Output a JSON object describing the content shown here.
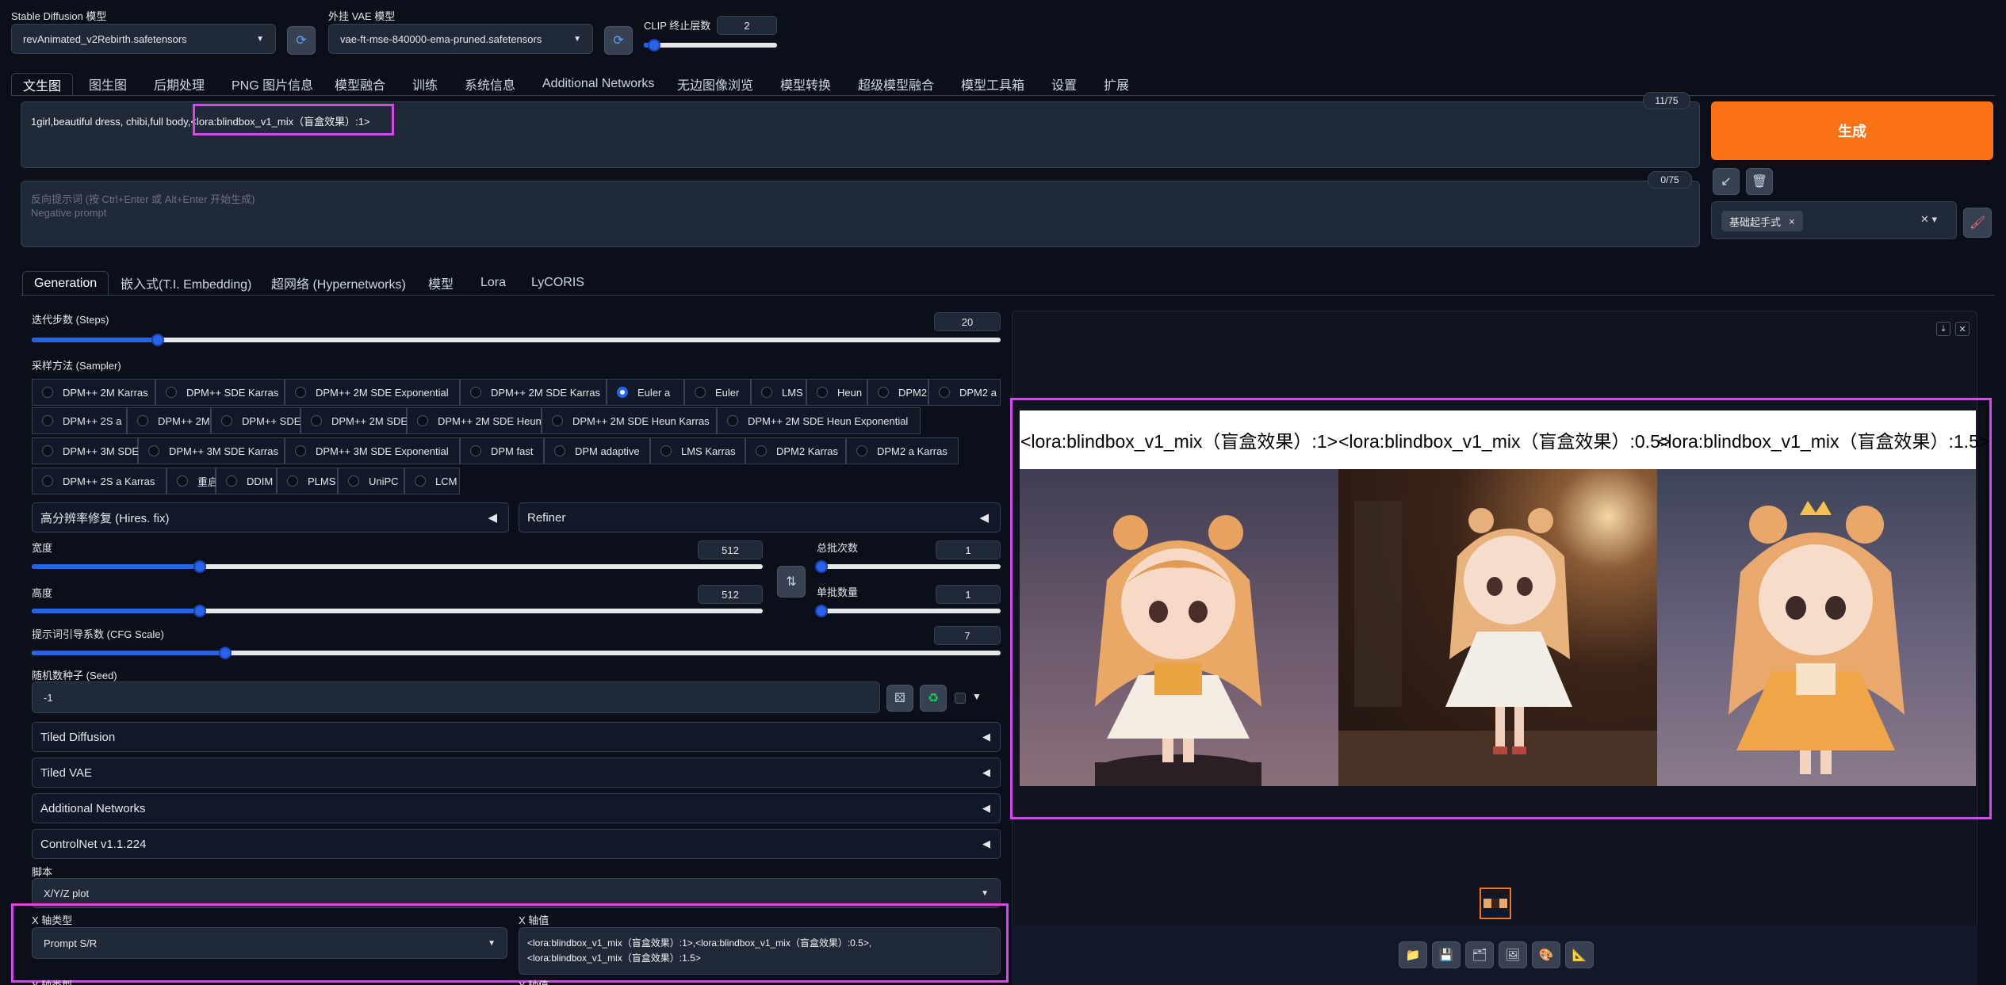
{
  "top": {
    "model_label": "Stable Diffusion 模型",
    "model_value": "revAnimated_v2Rebirth.safetensors",
    "vae_label": "外挂 VAE 模型",
    "vae_value": "vae-ft-mse-840000-ema-pruned.safetensors",
    "clip_label": "CLIP 终止层数",
    "clip_value": "2",
    "clip_level": 0.08
  },
  "tabs": [
    "文生图",
    "图生图",
    "后期处理",
    "PNG 图片信息",
    "模型融合",
    "训练",
    "系统信息",
    "Additional Networks",
    "无边图像浏览",
    "模型转换",
    "超级模型融合",
    "模型工具箱",
    "设置",
    "扩展"
  ],
  "prompt": {
    "text_before": "1girl,beautiful dress, chibi,full body,",
    "text_lora": "<lora:blindbox_v1_mix（盲盒效果）:1>",
    "count": "11/75",
    "neg_placeholder_1": "反向提示词 (按 Ctrl+Enter 或 Alt+Enter 开始生成)",
    "neg_placeholder_2": "Negative prompt",
    "neg_count": "0/75"
  },
  "generate": {
    "label": "生成",
    "style_tag": "基础起手式",
    "colors": {
      "accent": "#f97316"
    }
  },
  "subtabs": [
    "Generation",
    "嵌入式(T.I. Embedding)",
    "超网络 (Hypernetworks)",
    "模型",
    "Lora",
    "LyCORIS"
  ],
  "steps": {
    "label": "迭代步数 (Steps)",
    "value": "20",
    "level": 0.13
  },
  "sampler": {
    "label": "采样方法 (Sampler)",
    "selected": "Euler a",
    "rows": [
      [
        "DPM++ 2M Karras",
        "DPM++ SDE Karras",
        "DPM++ 2M SDE Exponential",
        "DPM++ 2M SDE Karras",
        "Euler a",
        "Euler",
        "LMS",
        "Heun",
        "DPM2",
        "DPM2 a"
      ],
      [
        "DPM++ 2S a",
        "DPM++ 2M",
        "DPM++ SDE",
        "DPM++ 2M SDE",
        "DPM++ 2M SDE Heun",
        "DPM++ 2M SDE Heun Karras",
        "DPM++ 2M SDE Heun Exponential"
      ],
      [
        "DPM++ 3M SDE",
        "DPM++ 3M SDE Karras",
        "DPM++ 3M SDE Exponential",
        "DPM fast",
        "DPM adaptive",
        "LMS Karras",
        "DPM2 Karras",
        "DPM2 a Karras"
      ],
      [
        "DPM++ 2S a Karras",
        "重启",
        "DDIM",
        "PLMS",
        "UniPC",
        "LCM"
      ]
    ]
  },
  "hires": {
    "label": "高分辨率修复 (Hires. fix)"
  },
  "refiner": {
    "label": "Refiner"
  },
  "width": {
    "label": "宽度",
    "value": "512",
    "level": 0.23
  },
  "height": {
    "label": "高度",
    "value": "512",
    "level": 0.23
  },
  "batch_count": {
    "label": "总批次数",
    "value": "1",
    "level": 0.0
  },
  "batch_size": {
    "label": "单批数量",
    "value": "1",
    "level": 0.0
  },
  "cfg": {
    "label": "提示词引导系数 (CFG Scale)",
    "value": "7",
    "level": 0.2
  },
  "seed": {
    "label": "随机数种子 (Seed)",
    "value": "-1"
  },
  "accordions": [
    "Tiled Diffusion",
    "Tiled VAE",
    "Additional Networks",
    "ControlNet v1.1.224"
  ],
  "script": {
    "label": "脚本",
    "value": "X/Y/Z plot"
  },
  "xaxis": {
    "type_label": "X 轴类型",
    "type_value": "Prompt S/R",
    "values_label": "X 轴值",
    "values_line1": "<lora:blindbox_v1_mix（盲盒效果）:1>,<lora:blindbox_v1_mix（盲盒效果）:0.5>,",
    "values_line2": "<lora:blindbox_v1_mix（盲盒效果）:1.5>"
  },
  "yaxis": {
    "type_label": "Y 轴类型",
    "values_label": "Y 轴值"
  },
  "output": {
    "grid_labels": [
      "<lora:blindbox_v1_mix（盲盒效果）:1>",
      "<lora:blindbox_v1_mix（盲盒效果）:0.5>",
      "<lora:blindbox_v1_mix（盲盒效果）:1.5>"
    ]
  }
}
